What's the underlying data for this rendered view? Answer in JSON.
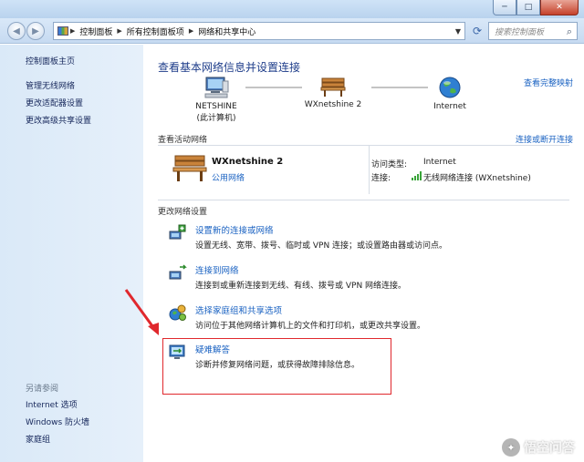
{
  "window": {
    "controls": {
      "minimize": "─",
      "maximize": "□",
      "close": "✕"
    }
  },
  "address_bar": {
    "crumbs": [
      "控制面板",
      "所有控制面板项",
      "网络和共享中心"
    ],
    "search_placeholder": "搜索控制面板"
  },
  "sidebar": {
    "items": [
      "控制面板主页",
      "管理无线网络",
      "更改适配器设置",
      "更改高级共享设置"
    ],
    "see_also_label": "另请参阅",
    "see_also_items": [
      "Internet 选项",
      "Windows 防火墙",
      "家庭组"
    ]
  },
  "main": {
    "heading": "查看基本网络信息并设置连接",
    "view_full_map": "查看完整映射",
    "map_nodes": [
      {
        "name": "NETSHINE",
        "sub": "(此计算机)"
      },
      {
        "name": "WXnetshine  2",
        "sub": ""
      },
      {
        "name": "Internet",
        "sub": ""
      }
    ],
    "active_networks": {
      "title": "查看活动网络",
      "connect_disconnect": "连接或断开连接",
      "network_name": "WXnetshine  2",
      "network_type": "公用网络",
      "access_type_label": "访问类型:",
      "access_type_value": "Internet",
      "connections_label": "连接:",
      "connections_value": "无线网络连接 (WXnetshine)"
    },
    "change_settings": {
      "title": "更改网络设置",
      "tasks": [
        {
          "title": "设置新的连接或网络",
          "desc": "设置无线、宽带、拨号、临时或 VPN 连接；或设置路由器或访问点。"
        },
        {
          "title": "连接到网络",
          "desc": "连接到或重新连接到无线、有线、拨号或 VPN 网络连接。"
        },
        {
          "title": "选择家庭组和共享选项",
          "desc": "访问位于其他网络计算机上的文件和打印机，或更改共享设置。"
        },
        {
          "title": "疑难解答",
          "desc": "诊断并修复网络问题，或获得故障排除信息。"
        }
      ]
    }
  },
  "watermark": {
    "text": "悟空问答"
  },
  "colors": {
    "link": "#1a62c2",
    "heading": "#1e3d8a",
    "annotation": "#e0282d"
  }
}
